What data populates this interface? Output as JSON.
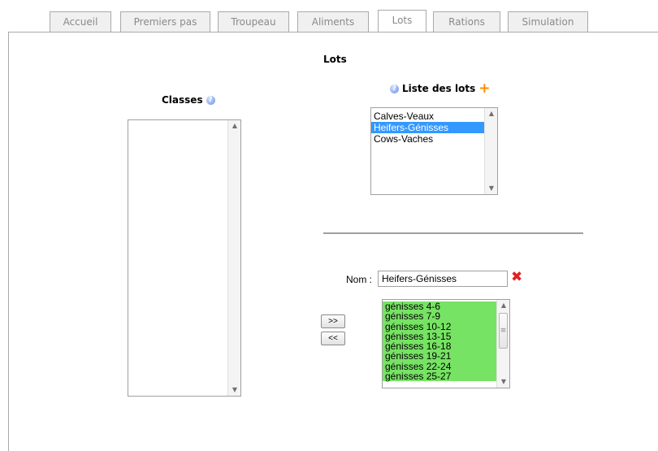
{
  "tabs": [
    {
      "label": "Accueil",
      "active": false
    },
    {
      "label": "Premiers pas",
      "active": false
    },
    {
      "label": "Troupeau",
      "active": false
    },
    {
      "label": "Aliments",
      "active": false
    },
    {
      "label": "Lots",
      "active": true
    },
    {
      "label": "Rations",
      "active": false
    },
    {
      "label": "Simulation",
      "active": false
    }
  ],
  "page_title": "Lots",
  "classes": {
    "label": "Classes",
    "help_icon": "help-icon",
    "items": []
  },
  "lots": {
    "label": "Liste des lots",
    "help_icon": "help-icon",
    "add_icon": "plus-icon",
    "items": [
      "Calves-Veaux",
      "Heifers-Génisses",
      "Cows-Vaches"
    ],
    "selected_index": 1
  },
  "editor": {
    "nom_label": "Nom :",
    "nom_value": "Heifers-Génisses",
    "delete_icon": "x-icon",
    "add_button": ">>",
    "remove_button": "<<",
    "groups": [
      "génisses 4-6",
      "génisses 7-9",
      "génisses 10-12",
      "génisses 13-15",
      "génisses 16-18",
      "génisses 19-21",
      "génisses 22-24",
      "génisses 25-27"
    ],
    "group_highlight_color": "#77e364"
  },
  "colors": {
    "selected": "#3399ff",
    "add": "#ff8c00",
    "delete": "#e02020"
  }
}
